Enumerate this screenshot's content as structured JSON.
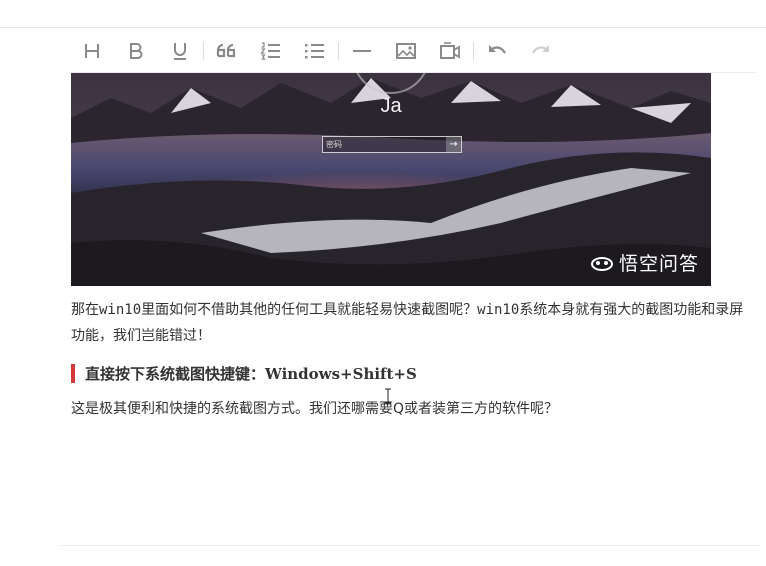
{
  "toolbar": {
    "buttons": [
      {
        "name": "heading",
        "icon": "heading-icon"
      },
      {
        "name": "bold",
        "icon": "bold-icon"
      },
      {
        "name": "underline",
        "icon": "underline-icon"
      },
      {
        "name": "quote",
        "icon": "quote-icon"
      },
      {
        "name": "ordered-list",
        "icon": "ordered-list-icon"
      },
      {
        "name": "unordered-list",
        "icon": "unordered-list-icon"
      },
      {
        "name": "horizontal-rule",
        "icon": "horizontal-rule-icon"
      },
      {
        "name": "image",
        "icon": "image-icon"
      },
      {
        "name": "video",
        "icon": "video-icon"
      },
      {
        "name": "undo",
        "icon": "undo-icon"
      },
      {
        "name": "redo",
        "icon": "redo-icon",
        "disabled": true
      }
    ],
    "icon_color": "#8a8a8a",
    "disabled_color": "#d0d0d0"
  },
  "screenshot": {
    "lock_screen_name": "Ja",
    "password_placeholder": "密码",
    "submit_arrow": "→",
    "watermark_text": "悟空问答",
    "watermark_icon": "wukong-logo-icon"
  },
  "article": {
    "paragraph1": "那在win10里面如何不借助其他的任何工具就能轻易快速截图呢？win10系统本身就有强大的截图功能和录屏功能，我们岂能错过！",
    "heading": "直接按下系统截图快捷键：Windows+Shift+S",
    "heading_bar_color": "#d43a3a",
    "paragraph2": "这是极其便利和快捷的系统截图方式。我们还哪需要Q或者装第三方的软件呢？"
  }
}
